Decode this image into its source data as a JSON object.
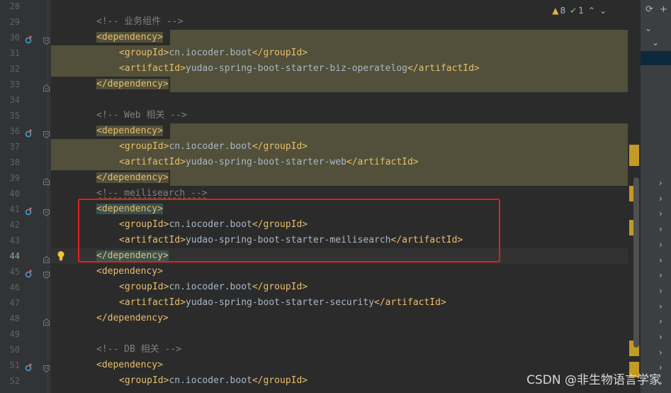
{
  "inspection": {
    "warnings_count": "8",
    "weak_warnings_count": "1",
    "prev_label": "⌃",
    "next_label": "⌄"
  },
  "lines": [
    {
      "n": "28",
      "parts": [],
      "block": false,
      "marker": false,
      "fold": ""
    },
    {
      "n": "29",
      "parts": [
        {
          "c": "cmt",
          "t": "<!-- 业务组件 -->"
        }
      ],
      "indent": 2,
      "marker": false,
      "fold": ""
    },
    {
      "n": "30",
      "parts": [
        {
          "c": "tag",
          "t": "<dependency>"
        }
      ],
      "indent": 2,
      "marker": true,
      "fold": "open",
      "hl": "tag"
    },
    {
      "n": "31",
      "parts": [
        {
          "c": "tag",
          "t": "<groupId>"
        },
        {
          "c": "txt",
          "t": "cn.iocoder.boot"
        },
        {
          "c": "tag",
          "t": "</groupId>"
        }
      ],
      "indent": 3,
      "marker": false,
      "fold": "",
      "hl": "block"
    },
    {
      "n": "32",
      "parts": [
        {
          "c": "tag",
          "t": "<artifactId>"
        },
        {
          "c": "txt",
          "t": "yudao-spring-boot-starter-biz-operatelog"
        },
        {
          "c": "tag",
          "t": "</artifactId>"
        }
      ],
      "indent": 3,
      "marker": false,
      "fold": "",
      "hl": "block"
    },
    {
      "n": "33",
      "parts": [
        {
          "c": "tag",
          "t": "</dependency>"
        }
      ],
      "indent": 2,
      "marker": false,
      "fold": "close",
      "hl": "tag"
    },
    {
      "n": "34",
      "parts": [],
      "marker": false,
      "fold": ""
    },
    {
      "n": "35",
      "parts": [
        {
          "c": "cmt",
          "t": "<!-- Web 相关 -->"
        }
      ],
      "indent": 2,
      "marker": false,
      "fold": ""
    },
    {
      "n": "36",
      "parts": [
        {
          "c": "tag",
          "t": "<dependency>"
        }
      ],
      "indent": 2,
      "marker": true,
      "fold": "open",
      "hl": "tag"
    },
    {
      "n": "37",
      "parts": [
        {
          "c": "tag",
          "t": "<groupId>"
        },
        {
          "c": "txt",
          "t": "cn.iocoder.boot"
        },
        {
          "c": "tag",
          "t": "</groupId>"
        }
      ],
      "indent": 3,
      "marker": false,
      "fold": "",
      "hl": "block"
    },
    {
      "n": "38",
      "parts": [
        {
          "c": "tag",
          "t": "<artifactId>"
        },
        {
          "c": "txt",
          "t": "yudao-spring-boot-starter-web"
        },
        {
          "c": "tag",
          "t": "</artifactId>"
        }
      ],
      "indent": 3,
      "marker": false,
      "fold": "",
      "hl": "block"
    },
    {
      "n": "39",
      "parts": [
        {
          "c": "tag",
          "t": "</dependency>"
        }
      ],
      "indent": 2,
      "marker": false,
      "fold": "close",
      "hl": "tag"
    },
    {
      "n": "40",
      "parts": [
        {
          "c": "cmt",
          "t": "<!-- meilisearch -->"
        }
      ],
      "indent": 2,
      "marker": false,
      "fold": ""
    },
    {
      "n": "41",
      "parts": [
        {
          "c": "tag",
          "t": "<dependency>"
        }
      ],
      "indent": 2,
      "marker": true,
      "fold": "open",
      "hl": "match"
    },
    {
      "n": "42",
      "parts": [
        {
          "c": "tag",
          "t": "<groupId>"
        },
        {
          "c": "txt",
          "t": "cn.iocoder.boot"
        },
        {
          "c": "tag",
          "t": "</groupId>"
        }
      ],
      "indent": 3,
      "marker": false,
      "fold": ""
    },
    {
      "n": "43",
      "parts": [
        {
          "c": "tag",
          "t": "<artifactId>"
        },
        {
          "c": "txt",
          "t": "yudao-spring-boot-starter-meilisearch"
        },
        {
          "c": "tag",
          "t": "</artifactId>"
        }
      ],
      "indent": 3,
      "marker": false,
      "fold": ""
    },
    {
      "n": "44",
      "parts": [
        {
          "c": "tag",
          "t": "</dependency>"
        }
      ],
      "indent": 2,
      "marker": false,
      "fold": "close",
      "hl": "match",
      "current": true,
      "bulb": true
    },
    {
      "n": "45",
      "parts": [
        {
          "c": "tag",
          "t": "<dependency>"
        }
      ],
      "indent": 2,
      "marker": true,
      "fold": "open"
    },
    {
      "n": "46",
      "parts": [
        {
          "c": "tag",
          "t": "<groupId>"
        },
        {
          "c": "txt",
          "t": "cn.iocoder.boot"
        },
        {
          "c": "tag",
          "t": "</groupId>"
        }
      ],
      "indent": 3,
      "marker": false,
      "fold": ""
    },
    {
      "n": "47",
      "parts": [
        {
          "c": "tag",
          "t": "<artifactId>"
        },
        {
          "c": "txt",
          "t": "yudao-spring-boot-starter-security"
        },
        {
          "c": "tag",
          "t": "</artifactId>"
        }
      ],
      "indent": 3,
      "marker": false,
      "fold": ""
    },
    {
      "n": "48",
      "parts": [
        {
          "c": "tag",
          "t": "</dependency>"
        }
      ],
      "indent": 2,
      "marker": false,
      "fold": "close"
    },
    {
      "n": "49",
      "parts": [],
      "marker": false,
      "fold": ""
    },
    {
      "n": "50",
      "parts": [
        {
          "c": "cmt",
          "t": "<!-- DB 相关 -->"
        }
      ],
      "indent": 2,
      "marker": false,
      "fold": ""
    },
    {
      "n": "51",
      "parts": [
        {
          "c": "tag",
          "t": "<dependency>"
        }
      ],
      "indent": 2,
      "marker": true,
      "fold": "open"
    },
    {
      "n": "52",
      "parts": [
        {
          "c": "tag",
          "t": "<groupId>"
        },
        {
          "c": "txt",
          "t": "cn.iocoder.boot"
        },
        {
          "c": "tag",
          "t": "</groupId>"
        }
      ],
      "indent": 3,
      "marker": false,
      "fold": ""
    }
  ],
  "watermark": "CSDN @非生物语言学家",
  "colors": {
    "editor_bg": "#2b2b2b",
    "tag": "#e8bf6a",
    "comment": "#808080",
    "text": "#a9b7c6",
    "highlight": "#52503a",
    "annotation_box": "#e02020"
  }
}
